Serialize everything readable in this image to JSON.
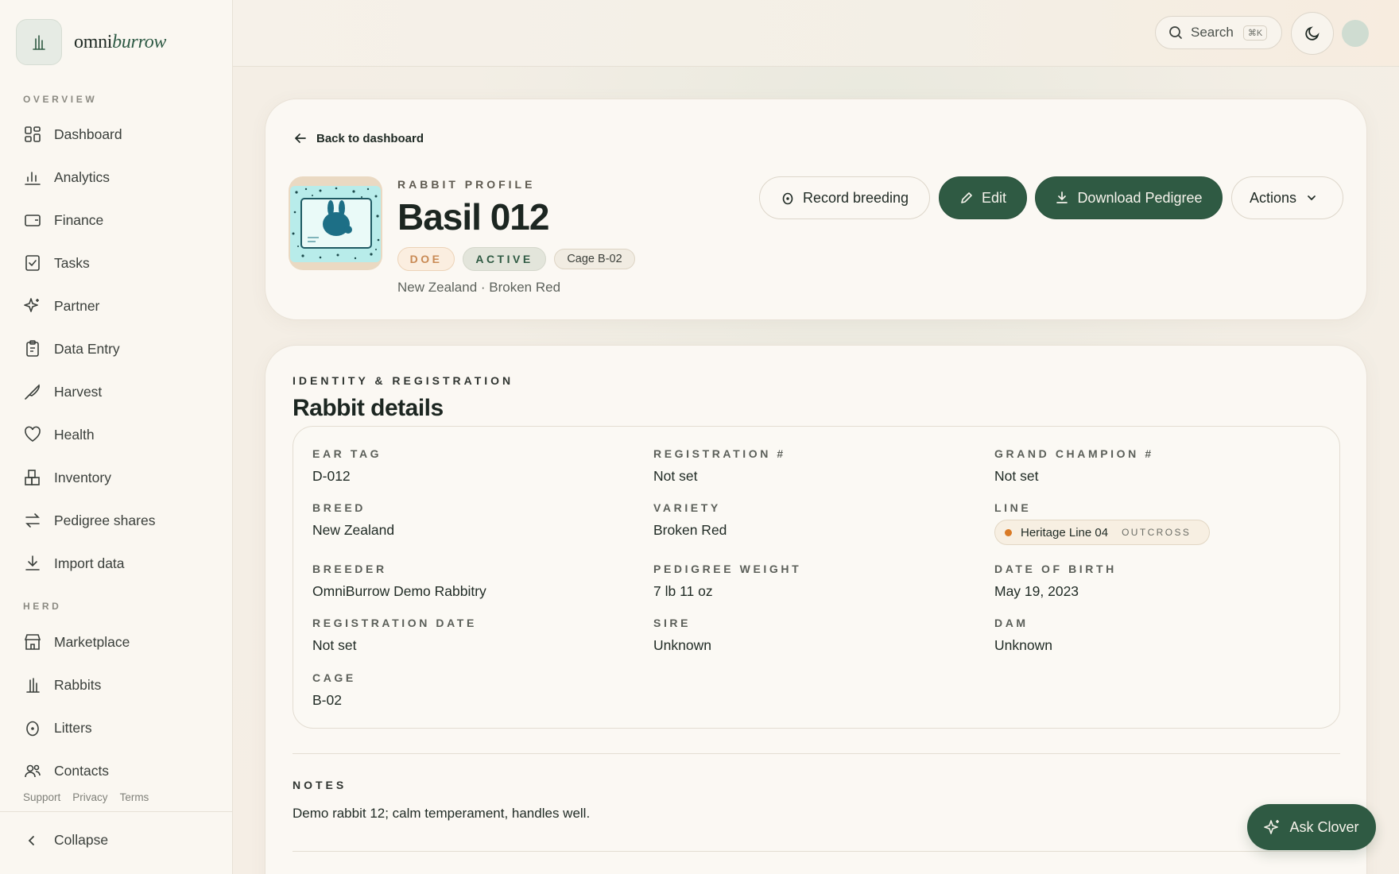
{
  "brand": {
    "name_plain": "omni",
    "name_italic": "burrow"
  },
  "sidebar": {
    "overview_label": "OVERVIEW",
    "overview_items": [
      {
        "label": "Dashboard",
        "icon": "dashboard-icon"
      },
      {
        "label": "Analytics",
        "icon": "analytics-icon"
      },
      {
        "label": "Finance",
        "icon": "wallet-icon"
      },
      {
        "label": "Tasks",
        "icon": "tasks-icon"
      },
      {
        "label": "Partner",
        "icon": "sparkle-icon"
      },
      {
        "label": "Data Entry",
        "icon": "clipboard-icon"
      },
      {
        "label": "Harvest",
        "icon": "knife-icon"
      },
      {
        "label": "Health",
        "icon": "heart-icon"
      },
      {
        "label": "Inventory",
        "icon": "boxes-icon"
      },
      {
        "label": "Pedigree shares",
        "icon": "swap-icon"
      },
      {
        "label": "Import data",
        "icon": "download-icon"
      }
    ],
    "herd_label": "HERD",
    "herd_items": [
      {
        "label": "Marketplace",
        "icon": "store-icon"
      },
      {
        "label": "Rabbits",
        "icon": "rabbit-icon"
      },
      {
        "label": "Litters",
        "icon": "egg-icon"
      },
      {
        "label": "Contacts",
        "icon": "contacts-icon"
      }
    ],
    "footer_links": [
      "Support",
      "Privacy",
      "Terms"
    ],
    "collapse_label": "Collapse"
  },
  "topbar": {
    "search_label": "Search",
    "search_shortcut": "⌘K"
  },
  "profile": {
    "back_label": "Back to dashboard",
    "eyebrow": "RABBIT PROFILE",
    "name": "Basil 012",
    "badges": {
      "sex": "DOE",
      "status": "ACTIVE",
      "cage": "Cage B-02"
    },
    "subtitle": "New Zealand · Broken Red",
    "actions": {
      "record_breeding": "Record breeding",
      "edit": "Edit",
      "download_pedigree": "Download Pedigree",
      "more": "Actions"
    }
  },
  "details": {
    "eyebrow": "IDENTITY & REGISTRATION",
    "title": "Rabbit details",
    "fields": {
      "ear_tag": {
        "label": "EAR TAG",
        "value": "D-012"
      },
      "registration_no": {
        "label": "REGISTRATION #",
        "value": "Not set"
      },
      "grand_champion_no": {
        "label": "GRAND CHAMPION #",
        "value": "Not set"
      },
      "breed": {
        "label": "BREED",
        "value": "New Zealand"
      },
      "variety": {
        "label": "VARIETY",
        "value": "Broken Red"
      },
      "line": {
        "label": "LINE",
        "value": "Heritage Line 04",
        "tag": "OUTCROSS"
      },
      "breeder": {
        "label": "BREEDER",
        "value": "OmniBurrow Demo Rabbitry"
      },
      "pedigree_weight": {
        "label": "PEDIGREE WEIGHT",
        "value": "7 lb 11 oz"
      },
      "date_of_birth": {
        "label": "DATE OF BIRTH",
        "value": "May 19, 2023"
      },
      "registration_date": {
        "label": "REGISTRATION DATE",
        "value": "Not set"
      },
      "sire": {
        "label": "SIRE",
        "value": "Unknown"
      },
      "dam": {
        "label": "DAM",
        "value": "Unknown"
      },
      "cage": {
        "label": "CAGE",
        "value": "B-02"
      }
    }
  },
  "notes": {
    "label": "NOTES",
    "text": "Demo rabbit 12; calm temperament, handles well."
  },
  "assistant": {
    "label": "Ask Clover"
  },
  "colors": {
    "accent": "#2f5a43",
    "doe_badge_text": "#c98a55",
    "line_dot": "#d97a26"
  }
}
